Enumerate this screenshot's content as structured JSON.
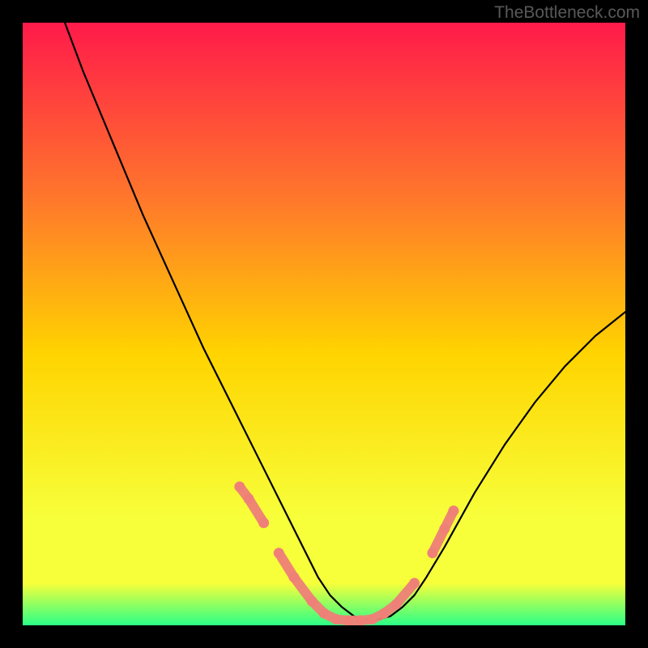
{
  "watermark": "TheBottleneck.com",
  "chart_data": {
    "type": "line",
    "title": "",
    "xlabel": "",
    "ylabel": "",
    "xlim": [
      0,
      100
    ],
    "ylim": [
      0,
      100
    ],
    "background_gradient": {
      "top": "#ff1a4a",
      "upper_mid": "#ff7a2a",
      "mid": "#ffd400",
      "lower_mid": "#f7ff3a",
      "bottom": "#2aff87"
    },
    "series": [
      {
        "name": "curve",
        "x": [
          7,
          10,
          15,
          20,
          25,
          30,
          35,
          40,
          45,
          47,
          49,
          51,
          53,
          55,
          57,
          59,
          61,
          63,
          65,
          67,
          70,
          75,
          80,
          85,
          90,
          95,
          100
        ],
        "y": [
          100,
          92,
          80,
          68,
          57,
          46,
          36,
          26,
          16,
          12,
          8,
          5,
          3,
          1.5,
          1,
          1,
          1.5,
          3,
          5,
          8,
          13,
          22,
          30,
          37,
          43,
          48,
          52
        ]
      }
    ],
    "marker_points": {
      "name": "coral-dots",
      "x": [
        36,
        37.5,
        40,
        42.5,
        45,
        48,
        50,
        52,
        54,
        56,
        58,
        60,
        62,
        65,
        68,
        70,
        71.5
      ],
      "y": [
        23,
        21,
        17,
        12,
        8,
        4,
        2,
        1,
        0.8,
        0.8,
        1,
        2,
        3.5,
        7,
        12,
        16,
        19
      ]
    },
    "marker_color": "#ef8078"
  }
}
